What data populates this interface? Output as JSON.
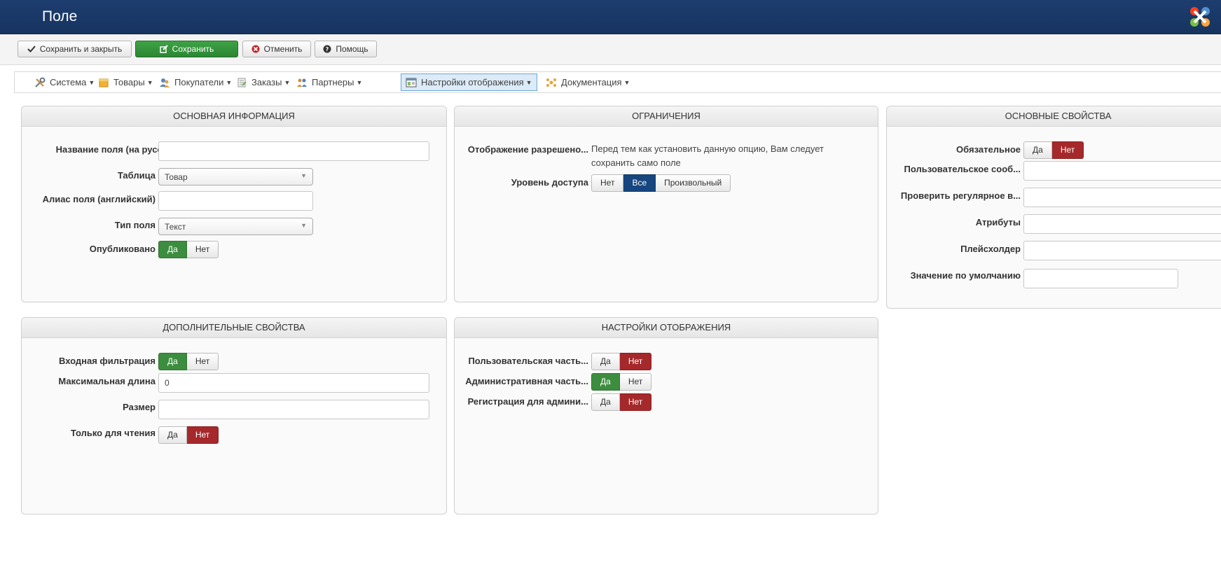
{
  "header": {
    "title": "Поле"
  },
  "toolbar": {
    "save_close": "Сохранить и закрыть",
    "save": "Сохранить",
    "cancel": "Отменить",
    "help": "Помощь"
  },
  "menu": {
    "items": [
      {
        "label": "Система",
        "icon": "tools-icon"
      },
      {
        "label": "Товары",
        "icon": "products-icon"
      },
      {
        "label": "Покупатели",
        "icon": "users-icon"
      },
      {
        "label": "Заказы",
        "icon": "orders-icon"
      },
      {
        "label": "Партнеры",
        "icon": "partners-icon"
      },
      {
        "label": "Настройки отображения",
        "icon": "display-settings-icon"
      },
      {
        "label": "Документация",
        "icon": "documentation-icon"
      }
    ]
  },
  "basic": {
    "title": "ОСНОВНАЯ ИНФОРМАЦИЯ",
    "name_label": "Название поля (на русск...",
    "name_value": "",
    "table_label": "Таблица",
    "table_value": "Товар",
    "alias_label": "Алиас поля (английский)",
    "alias_value": "",
    "type_label": "Тип поля",
    "type_value": "Текст",
    "published_label": "Опубликовано",
    "yes": "Да",
    "no": "Нет"
  },
  "limits": {
    "title": "ОГРАНИЧЕНИЯ",
    "display_label": "Отображение разрешено...",
    "display_note_1": "Перед тем как установить данную опцию, Вам следует",
    "display_note_2": "сохранить само поле",
    "access_label": "Уровень доступа",
    "access_none": "Нет",
    "access_all": "Все",
    "access_custom": "Произвольный"
  },
  "props": {
    "title": "ОСНОВНЫЕ СВОЙСТВА",
    "required_label": "Обязательное",
    "user_msg_label": "Пользовательское сооб...",
    "regex_label": "Проверить регулярное в...",
    "attrs_label": "Атрибуты",
    "placeholder_label": "Плейсхолдер",
    "default_label": "Значение по умолчанию",
    "yes": "Да",
    "no": "Нет"
  },
  "extra": {
    "title": "ДОПОЛНИТЕЛЬНЫЕ СВОЙСТВА",
    "filter_label": "Входная фильтрация",
    "maxlen_label": "Максимальная длина",
    "maxlen_value": "0",
    "size_label": "Размер",
    "readonly_label": "Только для чтения",
    "yes": "Да",
    "no": "Нет"
  },
  "display": {
    "title": "НАСТРОЙКИ ОТОБРАЖЕНИЯ",
    "user_part_label": "Пользовательская часть...",
    "admin_part_label": "Административная часть...",
    "reg_label": "Регистрация для админи...",
    "yes": "Да",
    "no": "Нет"
  },
  "colors": {
    "header": "#1d3d6f",
    "green": "#3c8d3f",
    "red": "#a5282b",
    "blue": "#16457f"
  }
}
